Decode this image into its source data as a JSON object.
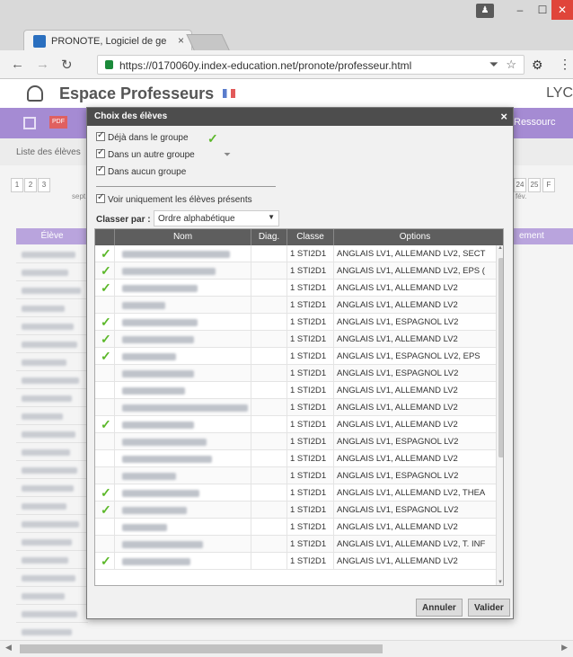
{
  "browser": {
    "tab_title": "PRONOTE, Logiciel de ge",
    "tab_close": "×",
    "url": "https://0170060y.index-education.net/pronote/professeur.html",
    "window_user": "♟",
    "window_min": "–",
    "window_max": "☐",
    "window_close": "✕"
  },
  "app": {
    "title": "Espace Professeurs",
    "right_label": "LYC",
    "toolbar_right": "Ressourc",
    "pdf_label": "PDF",
    "liste_label": "Liste des élèves",
    "weeks_left": [
      "1",
      "2",
      "3"
    ],
    "weeks_right": [
      "24",
      "25",
      "F"
    ],
    "month_left": "sept.",
    "month_right": "fév.",
    "col_left": "Élève",
    "col_right": "ement"
  },
  "dialog": {
    "title": "Choix des élèves",
    "close": "×",
    "checkboxes": [
      {
        "label": "Déjà dans le groupe",
        "checked": true
      },
      {
        "label": "Dans un autre groupe",
        "checked": true
      },
      {
        "label": "Dans aucun groupe",
        "checked": true
      }
    ],
    "present_only": {
      "label": "Voir uniquement les élèves présents",
      "checked": true
    },
    "sort_label": "Classer par :",
    "sort_value": "Ordre alphabétique",
    "columns": [
      "Nom",
      "Diag.",
      "Classe",
      "Options"
    ],
    "rows": [
      {
        "check": true,
        "classe": "1 STI2D1",
        "options": "ANGLAIS LV1, ALLEMAND LV2, SECT"
      },
      {
        "check": true,
        "classe": "1 STI2D1",
        "options": "ANGLAIS LV1, ALLEMAND LV2, EPS ("
      },
      {
        "check": true,
        "classe": "1 STI2D1",
        "options": "ANGLAIS LV1, ALLEMAND LV2"
      },
      {
        "check": false,
        "classe": "1 STI2D1",
        "options": "ANGLAIS LV1, ALLEMAND LV2"
      },
      {
        "check": true,
        "classe": "1 STI2D1",
        "options": "ANGLAIS LV1, ESPAGNOL LV2"
      },
      {
        "check": true,
        "classe": "1 STI2D1",
        "options": "ANGLAIS LV1, ALLEMAND LV2"
      },
      {
        "check": true,
        "classe": "1 STI2D1",
        "options": "ANGLAIS LV1, ESPAGNOL LV2, EPS"
      },
      {
        "check": false,
        "classe": "1 STI2D1",
        "options": "ANGLAIS LV1, ESPAGNOL LV2"
      },
      {
        "check": false,
        "classe": "1 STI2D1",
        "options": "ANGLAIS LV1, ALLEMAND LV2"
      },
      {
        "check": false,
        "classe": "1 STI2D1",
        "options": "ANGLAIS LV1, ALLEMAND LV2"
      },
      {
        "check": true,
        "classe": "1 STI2D1",
        "options": "ANGLAIS LV1, ALLEMAND LV2"
      },
      {
        "check": false,
        "classe": "1 STI2D1",
        "options": "ANGLAIS LV1, ESPAGNOL LV2"
      },
      {
        "check": false,
        "classe": "1 STI2D1",
        "options": "ANGLAIS LV1, ALLEMAND LV2"
      },
      {
        "check": false,
        "classe": "1 STI2D1",
        "options": "ANGLAIS LV1, ESPAGNOL LV2"
      },
      {
        "check": true,
        "classe": "1 STI2D1",
        "options": "ANGLAIS LV1, ALLEMAND LV2, THEA"
      },
      {
        "check": true,
        "classe": "1 STI2D1",
        "options": "ANGLAIS LV1, ESPAGNOL LV2"
      },
      {
        "check": false,
        "classe": "1 STI2D1",
        "options": "ANGLAIS LV1, ALLEMAND LV2"
      },
      {
        "check": false,
        "classe": "1 STI2D1",
        "options": "ANGLAIS LV1, ALLEMAND LV2, T. INF"
      },
      {
        "check": true,
        "classe": "1 STI2D1",
        "options": "ANGLAIS LV1, ALLEMAND LV2"
      }
    ],
    "cancel_label": "Annuler",
    "validate_label": "Valider"
  },
  "colors": {
    "toolbar": "#a58bd3",
    "dialog_title": "#4d4d4d",
    "check_green": "#5cb82a",
    "window_close": "#e0453a"
  }
}
